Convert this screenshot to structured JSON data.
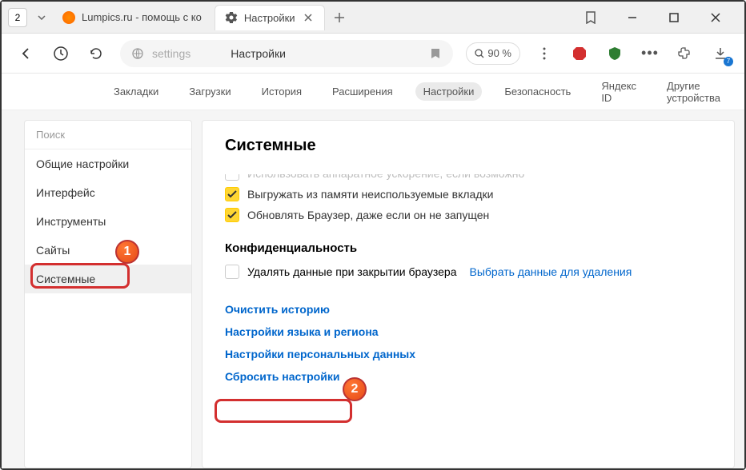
{
  "tabs": {
    "counter": "2",
    "inactive": {
      "title": "Lumpics.ru - помощь с ко"
    },
    "active": {
      "title": "Настройки"
    }
  },
  "toolbar": {
    "address": "settings",
    "page_title": "Настройки",
    "zoom": "90 %",
    "download_badge": "7"
  },
  "settings_tabs": {
    "items": [
      "Закладки",
      "Загрузки",
      "История",
      "Расширения",
      "Настройки",
      "Безопасность",
      "Яндекс ID",
      "Другие устройства"
    ],
    "t0": "Закладки",
    "t1": "Загрузки",
    "t2": "История",
    "t3": "Расширения",
    "t4": "Настройки",
    "t5": "Безопасность",
    "t6": "Яндекс ID",
    "t7": "Другие устройства"
  },
  "sidebar": {
    "search_placeholder": "Поиск",
    "i0": "Общие настройки",
    "i1": "Интерфейс",
    "i2": "Инструменты",
    "i3": "Сайты",
    "i4": "Системные"
  },
  "panel": {
    "title": "Системные",
    "c0": "Использовать аппаратное ускорение, если возможно",
    "c1": "Выгружать из памяти неиспользуемые вкладки",
    "c2": "Обновлять Браузер, даже если он не запущен",
    "privacy_title": "Конфиденциальность",
    "privacy_check": "Удалять данные при закрытии браузера",
    "privacy_link": "Выбрать данные для удаления",
    "l0": "Очистить историю",
    "l1": "Настройки языка и региона",
    "l2": "Настройки персональных данных",
    "l3": "Сбросить настройки"
  },
  "annotations": {
    "n1": "1",
    "n2": "2"
  }
}
